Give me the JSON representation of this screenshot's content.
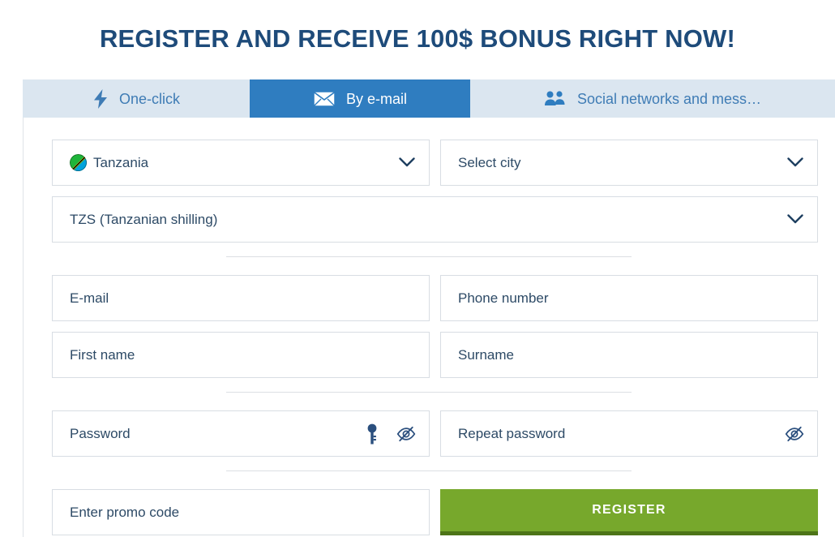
{
  "header": {
    "title": "REGISTER AND RECEIVE 100$ BONUS RIGHT NOW!",
    "title_color": "#1e4b7a"
  },
  "tabs": {
    "items": [
      {
        "id": "one-click",
        "label": "One-click",
        "icon": "lightning-bolt-icon",
        "active": false
      },
      {
        "id": "by-email",
        "label": "By e-mail",
        "icon": "envelope-icon",
        "active": true
      },
      {
        "id": "social",
        "label": "Social networks and mess…",
        "icon": "people-group-icon",
        "active": false
      }
    ],
    "bar_background": "#dbe6f0",
    "active_background": "#2f7dc0",
    "inactive_text": "#3f7cb5",
    "active_text": "#ffffff"
  },
  "form": {
    "country": {
      "value": "Tanzania",
      "flag": "tanzania-flag-icon",
      "chevron": "chevron-down-icon"
    },
    "city": {
      "placeholder": "Select city",
      "chevron": "chevron-down-icon"
    },
    "currency": {
      "value": "TZS (Tanzanian shilling)",
      "chevron": "chevron-down-icon"
    },
    "email": {
      "placeholder": "E-mail",
      "value": ""
    },
    "phone": {
      "placeholder": "Phone number",
      "value": ""
    },
    "first_name": {
      "placeholder": "First name",
      "value": ""
    },
    "surname": {
      "placeholder": "Surname",
      "value": ""
    },
    "password": {
      "placeholder": "Password",
      "value": "",
      "generate_icon": "key-icon",
      "toggle_icon": "eye-slash-icon"
    },
    "repeat_password": {
      "placeholder": "Repeat password",
      "value": "",
      "toggle_icon": "eye-slash-icon"
    },
    "promo_code": {
      "placeholder": "Enter promo code",
      "value": ""
    },
    "submit": {
      "label": "REGISTER",
      "color": "#77a82c",
      "shadow_color": "#4d7418",
      "text_color": "#ffffff"
    }
  }
}
